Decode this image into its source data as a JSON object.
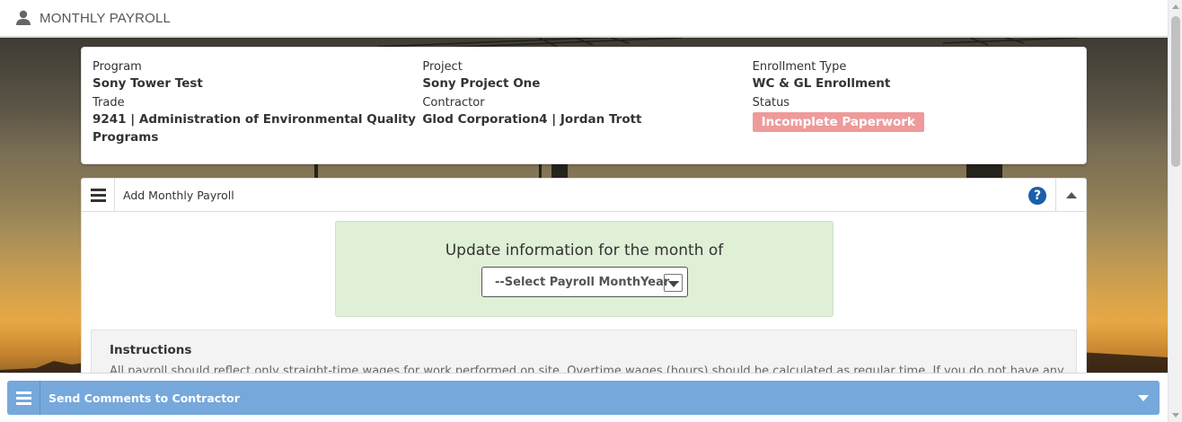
{
  "header": {
    "title": "MONTHLY PAYROLL",
    "icon": "user-icon"
  },
  "info": {
    "program_label": "Program",
    "program_value": "Sony Tower Test",
    "trade_label": "Trade",
    "trade_value": "9241 | Administration of Environmental Quality Programs",
    "project_label": "Project",
    "project_value": "Sony Project One",
    "contractor_label": "Contractor",
    "contractor_value": "Glod Corporation4 | Jordan Trott",
    "enrollment_label": "Enrollment Type",
    "enrollment_value": "WC & GL Enrollment",
    "status_label": "Status",
    "status_value": "Incomplete Paperwork",
    "status_color": "#ef9a9a"
  },
  "payroll_panel": {
    "title": "Add Monthly Payroll",
    "help_icon": "question-circle-icon",
    "help_glyph": "?",
    "month_prompt": "Update information for the month of",
    "month_select_value": "--Select Payroll MonthYear--",
    "month_box_color": "#dff0d6"
  },
  "instructions": {
    "title": "Instructions",
    "text": "All payroll should reflect only straight-time wages for work performed on site. Overtime wages (hours) should be calculated as regular time. If you do not have any"
  },
  "comments_bar": {
    "title": "Send Comments to Contractor",
    "color": "#76a8dc"
  }
}
